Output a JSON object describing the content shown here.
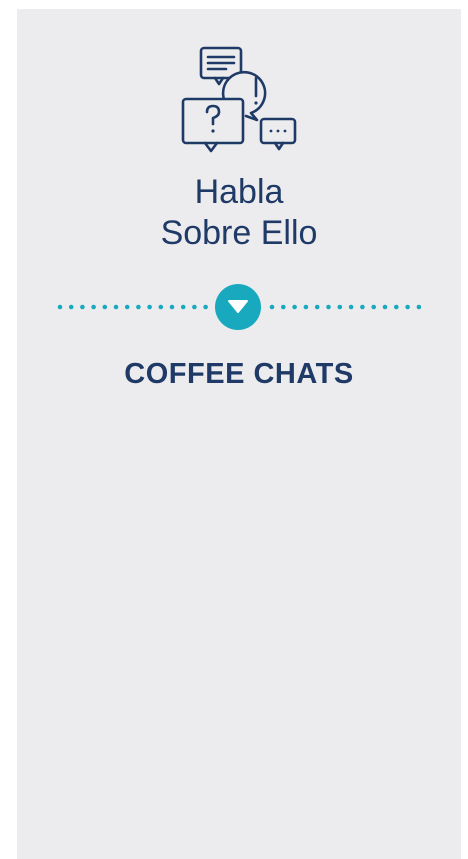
{
  "card": {
    "icon": "conversation-bubbles-icon",
    "title_line1": "Habla",
    "title_line2": "Sobre Ello",
    "toggle_icon": "caret-down-icon",
    "subheading": "COFFEE CHATS"
  },
  "colors": {
    "background": "#ececee",
    "text": "#1f3a66",
    "accent": "#19a9bf"
  }
}
